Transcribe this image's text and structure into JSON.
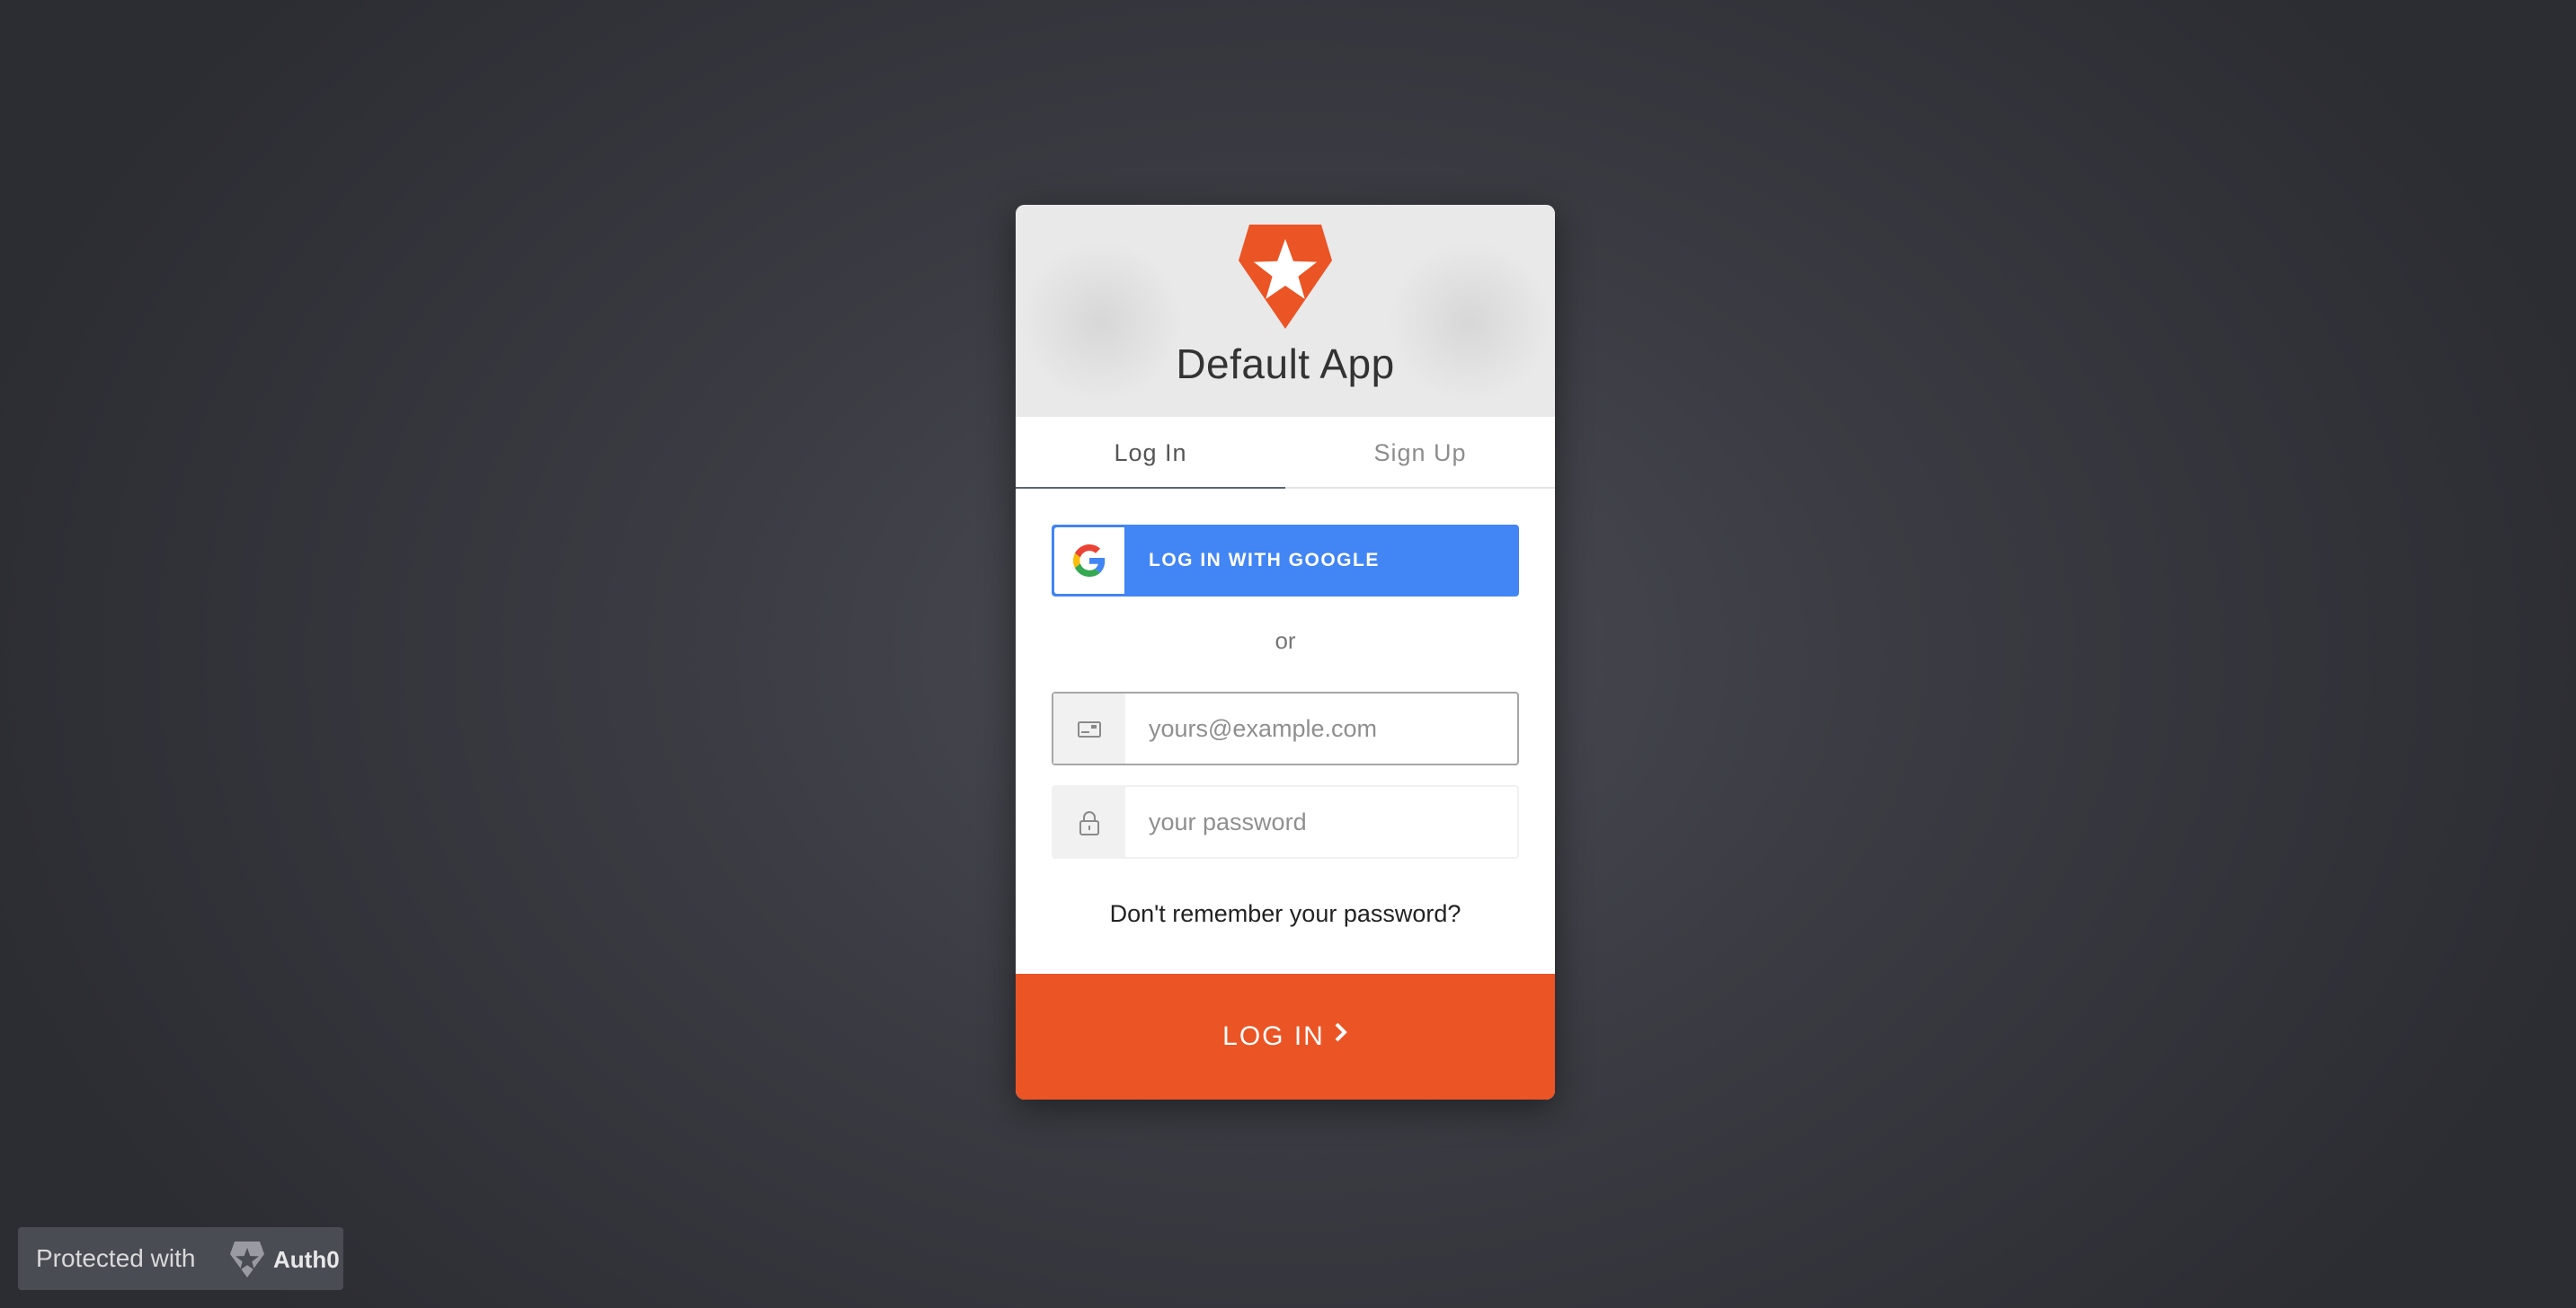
{
  "app": {
    "title": "Default App",
    "accent_color": "#eb5424",
    "logo_icon": "auth0-shield-star-icon"
  },
  "tabs": [
    {
      "label": "Log In",
      "active": true
    },
    {
      "label": "Sign Up",
      "active": false
    }
  ],
  "social": {
    "google_label": "LOG IN WITH GOOGLE",
    "google_color": "#4285f4",
    "icon": "google-g-icon"
  },
  "divider": {
    "text": "or"
  },
  "form": {
    "email": {
      "placeholder": "yours@example.com",
      "value": "",
      "icon": "envelope-icon"
    },
    "password": {
      "placeholder": "your password",
      "value": "",
      "icon": "lock-icon"
    },
    "forgot_label": "Don't remember your password?",
    "submit_label": "LOG IN",
    "submit_icon": "chevron-right-icon"
  },
  "footer_badge": {
    "text": "Protected with",
    "brand": "Auth0",
    "icon": "auth0-badge-icon"
  }
}
